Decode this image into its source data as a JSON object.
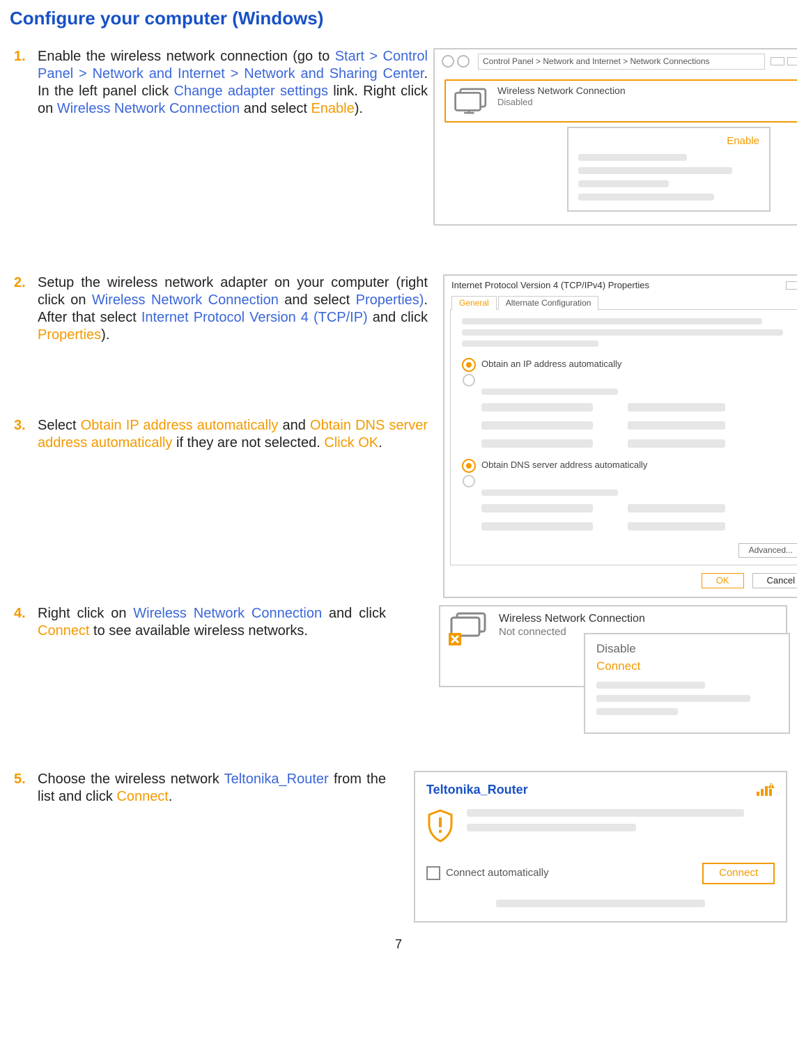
{
  "title": "Configure your computer (Windows)",
  "footer": "7",
  "steps": {
    "s1": {
      "p1a": "Enable the wireless network connection (go to ",
      "p1_link1": "Start > Control Panel > Network and Internet > Network and Sharing Center",
      "p1b": ". In the left panel click ",
      "p1_link2": "Change adapter settings",
      "p1c": " link. Right click on ",
      "p1_link3": "Wireless Network Connection",
      "p1d": " and select ",
      "p1_act": "Enable",
      "p1e": ")."
    },
    "s2": {
      "p2a": "Setup the wireless network adapter on your computer (right click on ",
      "p2_link1": "Wireless Network Connection",
      "p2b": " and select ",
      "p2_link2": "Properties)",
      "p2c": ". After that select ",
      "p2_link3": "Internet Protocol Version 4 (TCP/IP)",
      "p2d": " and click ",
      "p2_act": "Properties",
      "p2e": ")."
    },
    "s3": {
      "p3a": "Select ",
      "p3_act1": "Obtain IP address automatically",
      "p3b": " and ",
      "p3_act2": "Obtain DNS server address automatically",
      "p3c": " if they are not selected. ",
      "p3_act3": "Click OK",
      "p3d": "."
    },
    "s4": {
      "p4a": "Right click on ",
      "p4_link1": "Wireless Network Connection",
      "p4b": " and click ",
      "p4_act": "Connect",
      "p4c": " to see available wireless networks."
    },
    "s5": {
      "p5a": "Choose the wireless network ",
      "p5_link1": "Teltonika_Router",
      "p5b": " from the list and click ",
      "p5_act": "Connect",
      "p5c": "."
    }
  },
  "win1": {
    "breadcrumb": "Control Panel > Network and Internet > Network Connections",
    "conn_name": "Wireless Network Connection",
    "conn_status": "Disabled",
    "menu_enable": "Enable"
  },
  "win2": {
    "title": "Internet Protocol Version 4 (TCP/IPv4) Properties",
    "tab_general": "General",
    "tab_alt": "Alternate Configuration",
    "radio_ip": "Obtain an IP address automatically",
    "radio_dns": "Obtain DNS server address automatically",
    "advanced": "Advanced...",
    "ok": "OK",
    "cancel": "Cancel"
  },
  "win4": {
    "title": "Wireless Network Connection",
    "status": "Not connected",
    "disable": "Disable",
    "connect": "Connect"
  },
  "win5": {
    "ssid": "Teltonika_Router",
    "auto": "Connect automatically",
    "connect": "Connect"
  }
}
